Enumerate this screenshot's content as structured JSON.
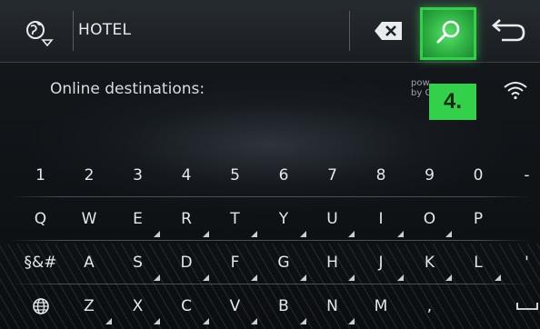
{
  "search": {
    "query": "HOTEL"
  },
  "results": {
    "label": "Online destinations:",
    "powered_by_line1": "pow",
    "powered_by_line2": "by G"
  },
  "annotation": {
    "step_label": "4."
  },
  "colors": {
    "highlight": "#33d14a",
    "bar": "#22272c"
  },
  "keyboard": {
    "rows": [
      [
        "1",
        "2",
        "3",
        "4",
        "5",
        "6",
        "7",
        "8",
        "9",
        "0",
        "-"
      ],
      [
        "Q",
        "W",
        "E",
        "R",
        "T",
        "Y",
        "U",
        "I",
        "O",
        "P",
        ""
      ],
      [
        "§&#",
        "A",
        "S",
        "D",
        "F",
        "G",
        "H",
        "J",
        "K",
        "L",
        "'"
      ],
      [
        "globe-icon",
        "Z",
        "X",
        "C",
        "V",
        "B",
        "N",
        "M",
        ",",
        "",
        "space-icon"
      ]
    ],
    "accented": [
      [],
      [
        "E",
        "R",
        "T",
        "Y",
        "U",
        "I",
        "O"
      ],
      [
        "S",
        "D",
        "F",
        "G",
        "H",
        "J",
        "K",
        "L"
      ],
      [
        "Z",
        "X",
        "C",
        "V",
        "B",
        "N"
      ]
    ]
  },
  "icons": {
    "globe": "globe-icon",
    "clear": "backspace-icon",
    "search": "search-icon",
    "back": "back-arrow-icon",
    "wifi": "wifi-icon",
    "space": "space-icon"
  }
}
